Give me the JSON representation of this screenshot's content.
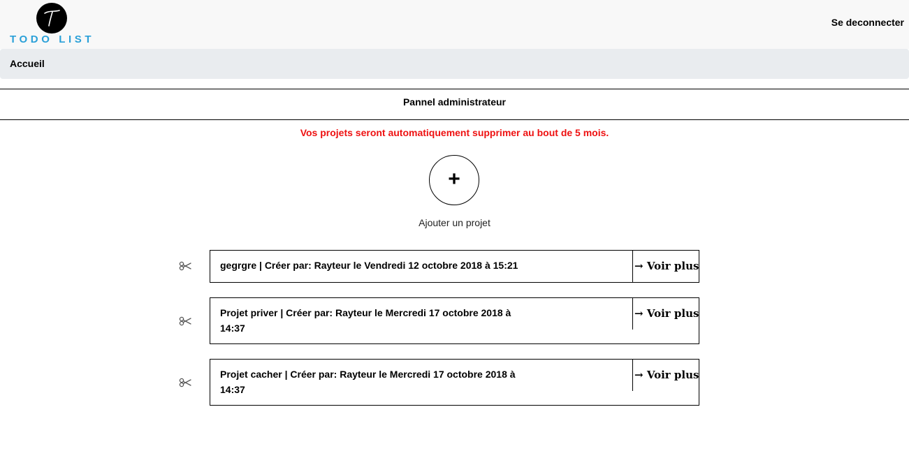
{
  "header": {
    "logo_letter_icon": "t-letter-logo",
    "logo_text": "TODO LIST",
    "logout_label": "Se deconnecter",
    "logo_text_color": "#2aa0d8"
  },
  "breadcrumb": {
    "items": [
      "Accueil"
    ]
  },
  "panel": {
    "title": "Pannel administrateur",
    "warning": "Vos projets seront automatiquement supprimer au bout de 5 mois.",
    "warning_color": "#ee1111",
    "add_button_symbol": "+",
    "add_label": "Ajouter un projet"
  },
  "projects": [
    {
      "delete_icon": "scissors-icon",
      "line1": "gegrgre | Créer par: Rayteur le Vendredi 12 octobre 2018 à 15:21",
      "line2": "",
      "action_label": "Voir plus"
    },
    {
      "delete_icon": "scissors-icon",
      "line1": "Projet priver | Créer par: Rayteur le Mercredi 17 octobre 2018 à",
      "line2": "14:37",
      "action_label": "Voir plus"
    },
    {
      "delete_icon": "scissors-icon",
      "line1": "Projet cacher | Créer par: Rayteur le Mercredi 17 octobre 2018 à",
      "line2": "14:37",
      "action_label": "Voir plus"
    }
  ]
}
